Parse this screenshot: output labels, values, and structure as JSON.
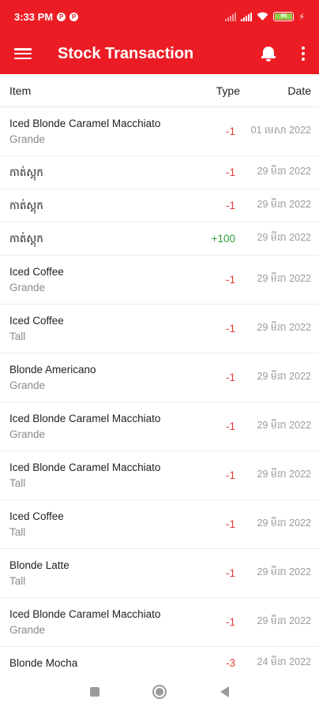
{
  "status_bar": {
    "time": "3:33 PM",
    "battery_level": "96"
  },
  "app_bar": {
    "title": "Stock Transaction"
  },
  "table": {
    "headers": {
      "item": "Item",
      "type": "Type",
      "date": "Date"
    },
    "rows": [
      {
        "name": "Iced Blonde Caramel Macchiato",
        "size": "Grande",
        "type": "-1",
        "date": "01 មេសា 2022"
      },
      {
        "name": "កាត់ស្តុក",
        "size": "",
        "type": "-1",
        "date": "29 មីនា 2022"
      },
      {
        "name": "កាត់ស្តុក",
        "size": "",
        "type": "-1",
        "date": "29 មីនា 2022"
      },
      {
        "name": "កាត់ស្តុក",
        "size": "",
        "type": "+100",
        "date": "29 មីនា 2022"
      },
      {
        "name": "Iced Coffee",
        "size": "Grande",
        "type": "-1",
        "date": "29 មីនា 2022"
      },
      {
        "name": "Iced Coffee",
        "size": "Tall",
        "type": "-1",
        "date": "29 មីនា 2022"
      },
      {
        "name": "Blonde Americano",
        "size": "Grande",
        "type": "-1",
        "date": "29 មីនា 2022"
      },
      {
        "name": "Iced Blonde Caramel Macchiato",
        "size": "Grande",
        "type": "-1",
        "date": "29 មីនា 2022"
      },
      {
        "name": "Iced Blonde Caramel Macchiato",
        "size": "Tall",
        "type": "-1",
        "date": "29 មីនា 2022"
      },
      {
        "name": "Iced Coffee",
        "size": "Tall",
        "type": "-1",
        "date": "29 មីនា 2022"
      },
      {
        "name": "Blonde Latte",
        "size": "Tall",
        "type": "-1",
        "date": "29 មីនា 2022"
      },
      {
        "name": "Iced Blonde Caramel Macchiato",
        "size": "Grande",
        "type": "-1",
        "date": "29 មីនា 2022"
      },
      {
        "name": "Blonde Mocha",
        "size": "",
        "type": "-3",
        "date": "24 មីនា 2022"
      }
    ]
  },
  "icons": {
    "menu": "menu-icon",
    "notifications": "bell-icon",
    "overflow": "more-vert-icon",
    "nav_recents": "square-icon",
    "nav_home": "circle-icon",
    "nav_back": "triangle-back-icon"
  },
  "colors": {
    "brand": "#ec1c24",
    "negative": "#e53935",
    "positive": "#2e9e3c"
  }
}
